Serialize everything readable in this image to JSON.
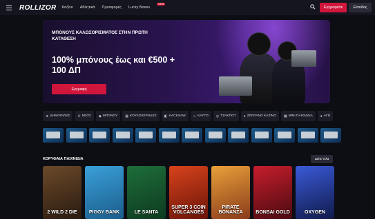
{
  "header": {
    "logo": "ROLLIZOR",
    "nav": [
      "Καζίνο",
      "Αθλητικά",
      "Προσφορές",
      "Lucky Boxes"
    ],
    "new_badge": "NEW",
    "register": "Εγγραφείτε",
    "login": "Είσοδος"
  },
  "banner": {
    "small_title": "ΜΠΟΝΟΥΣ ΚΑΛΩΣΟΡΙΣΜΑΤΟΣ ΣΤΗΝ ΠΡΩΤΗ ΚΑΤΑΘΕΣΗ",
    "big_title": "100% μπόνους έως και €500 + 100 ΔΠ",
    "cta": "Εγγραφή"
  },
  "categories": [
    {
      "icon": "star-icon",
      "label": "ΔΗΜΟΦΙΛΕΣ"
    },
    {
      "icon": "new-icon",
      "label": "ΝΕΟΣ"
    },
    {
      "icon": "bonus-icon",
      "label": "ΜΠΟΝΟΥ"
    },
    {
      "icon": "slots-icon",
      "label": "ΚΟΥΛΟΧΕΡΗΔΕΣ"
    },
    {
      "icon": "provider-icon",
      "label": "HACKSAW"
    },
    {
      "icon": "flame-icon",
      "label": "ΚΑΥΤΟ"
    },
    {
      "icon": "jackpot-icon",
      "label": "ΤΖΑΚΠΟΤ"
    },
    {
      "icon": "live-icon",
      "label": "ΖΩΝΤΑΝΟ ΚΑΖΙΝΟ"
    },
    {
      "icon": "mini-games-icon",
      "label": "MINI ΠΑΙΧΝΙΔΙΑ"
    },
    {
      "icon": "more-icon",
      "label": "ΑΓΩ"
    }
  ],
  "section": {
    "title": "ΚΟΡΥΦΑΙΑ ΠΑΙΧΝΙΔΙΑ",
    "see_all": "Δείτε Όλα"
  },
  "games": [
    {
      "title": "2 WILD 2 DIE",
      "c1": "#6b4a2a",
      "c2": "#2a1a10"
    },
    {
      "title": "PIGGY BANK",
      "c1": "#3aa0d8",
      "c2": "#1b5d8c"
    },
    {
      "title": "LE SANTA",
      "c1": "#1e6e3a",
      "c2": "#0d3a20"
    },
    {
      "title": "SUPER 3 COIN VOLCANOES",
      "c1": "#d8431c",
      "c2": "#6a1408"
    },
    {
      "title": "PIRATE BONANZA",
      "c1": "#e8a13a",
      "c2": "#8a3a1a"
    },
    {
      "title": "BONSAI GOLD",
      "c1": "#c71e2d",
      "c2": "#4a0a10"
    },
    {
      "title": "OXYGEN",
      "c1": "#3a5ad8",
      "c2": "#101a4a"
    }
  ]
}
